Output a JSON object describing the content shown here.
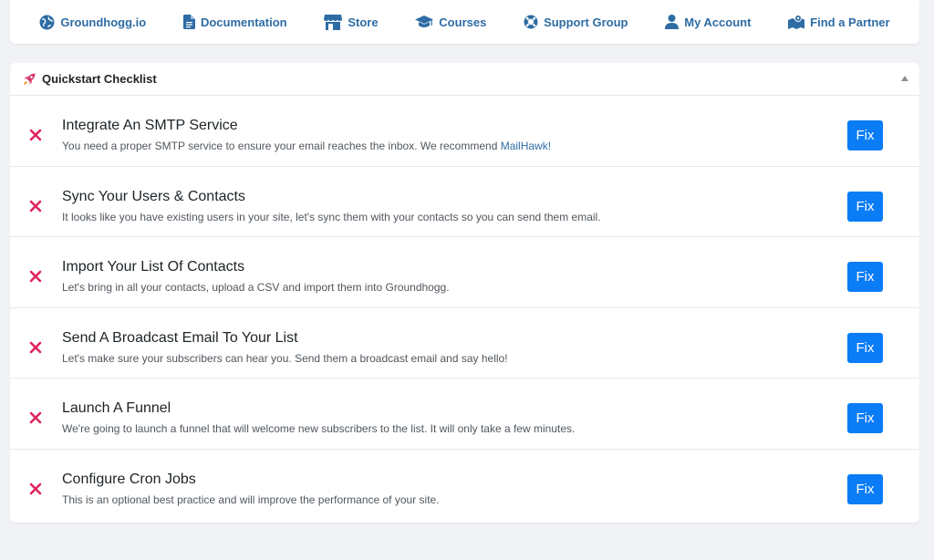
{
  "nav": {
    "items": [
      {
        "label": "Groundhogg.io",
        "icon": "globe-icon"
      },
      {
        "label": "Documentation",
        "icon": "document-icon"
      },
      {
        "label": "Store",
        "icon": "store-icon"
      },
      {
        "label": "Courses",
        "icon": "graduation-cap-icon"
      },
      {
        "label": "Support Group",
        "icon": "lifebuoy-icon"
      },
      {
        "label": "My Account",
        "icon": "user-icon"
      },
      {
        "label": "Find a Partner",
        "icon": "map-pin-icon"
      }
    ]
  },
  "checklist": {
    "title": "Quickstart Checklist",
    "fix_label": "Fix",
    "tasks": [
      {
        "title": "Integrate An SMTP Service",
        "desc": "You need a proper SMTP service to ensure your email reaches the inbox. We recommend",
        "link": "MailHawk!"
      },
      {
        "title": "Sync Your Users & Contacts",
        "desc": "It looks like you have existing users in your site, let's sync them with your contacts so you can send them email."
      },
      {
        "title": "Import Your List Of Contacts",
        "desc": "Let's bring in all your contacts, upload a CSV and import them into Groundhogg."
      },
      {
        "title": "Send A Broadcast Email To Your List",
        "desc": "Let's make sure your subscribers can hear you. Send them a broadcast email and say hello!"
      },
      {
        "title": "Launch A Funnel",
        "desc": "We're going to launch a funnel that will welcome new subscribers to the list. It will only take a few minutes."
      },
      {
        "title": "Configure Cron Jobs",
        "desc": "This is an optional best practice and will improve the performance of your site."
      }
    ]
  },
  "colors": {
    "link": "#2e6ca4",
    "incomplete": "#e0245e",
    "button": "#0a7cf6"
  }
}
